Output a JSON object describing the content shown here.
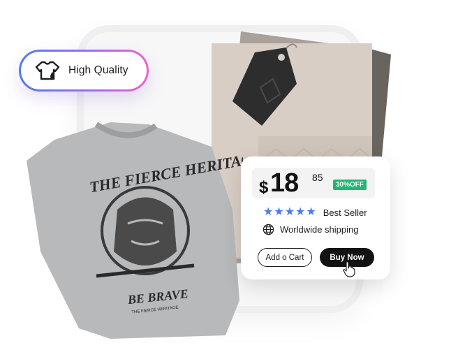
{
  "badge": {
    "label": "High Quality",
    "icon": "shirt-drop-icon",
    "gradient": [
      "#4f7cf5",
      "#9b6cf2",
      "#ee63c8"
    ]
  },
  "product_card": {
    "price": {
      "currency": "$",
      "whole": "18",
      "cents": "85"
    },
    "discount_label": "30%OFF",
    "discount_color": "#22b573",
    "rating": {
      "stars": 5,
      "label": "Best Seller",
      "star_color": "#4a7cf0"
    },
    "shipping": {
      "icon": "globe-icon",
      "label": "Worldwide shipping"
    },
    "add_to_cart_label": "Add o Cart",
    "buy_now_label": "Buy Now"
  },
  "shirt_print": {
    "top_text": "THE FIERCE HERITAGE",
    "bottom_text": "BE BRAVE",
    "small_text": "THE FIERCE HERITAGE"
  }
}
